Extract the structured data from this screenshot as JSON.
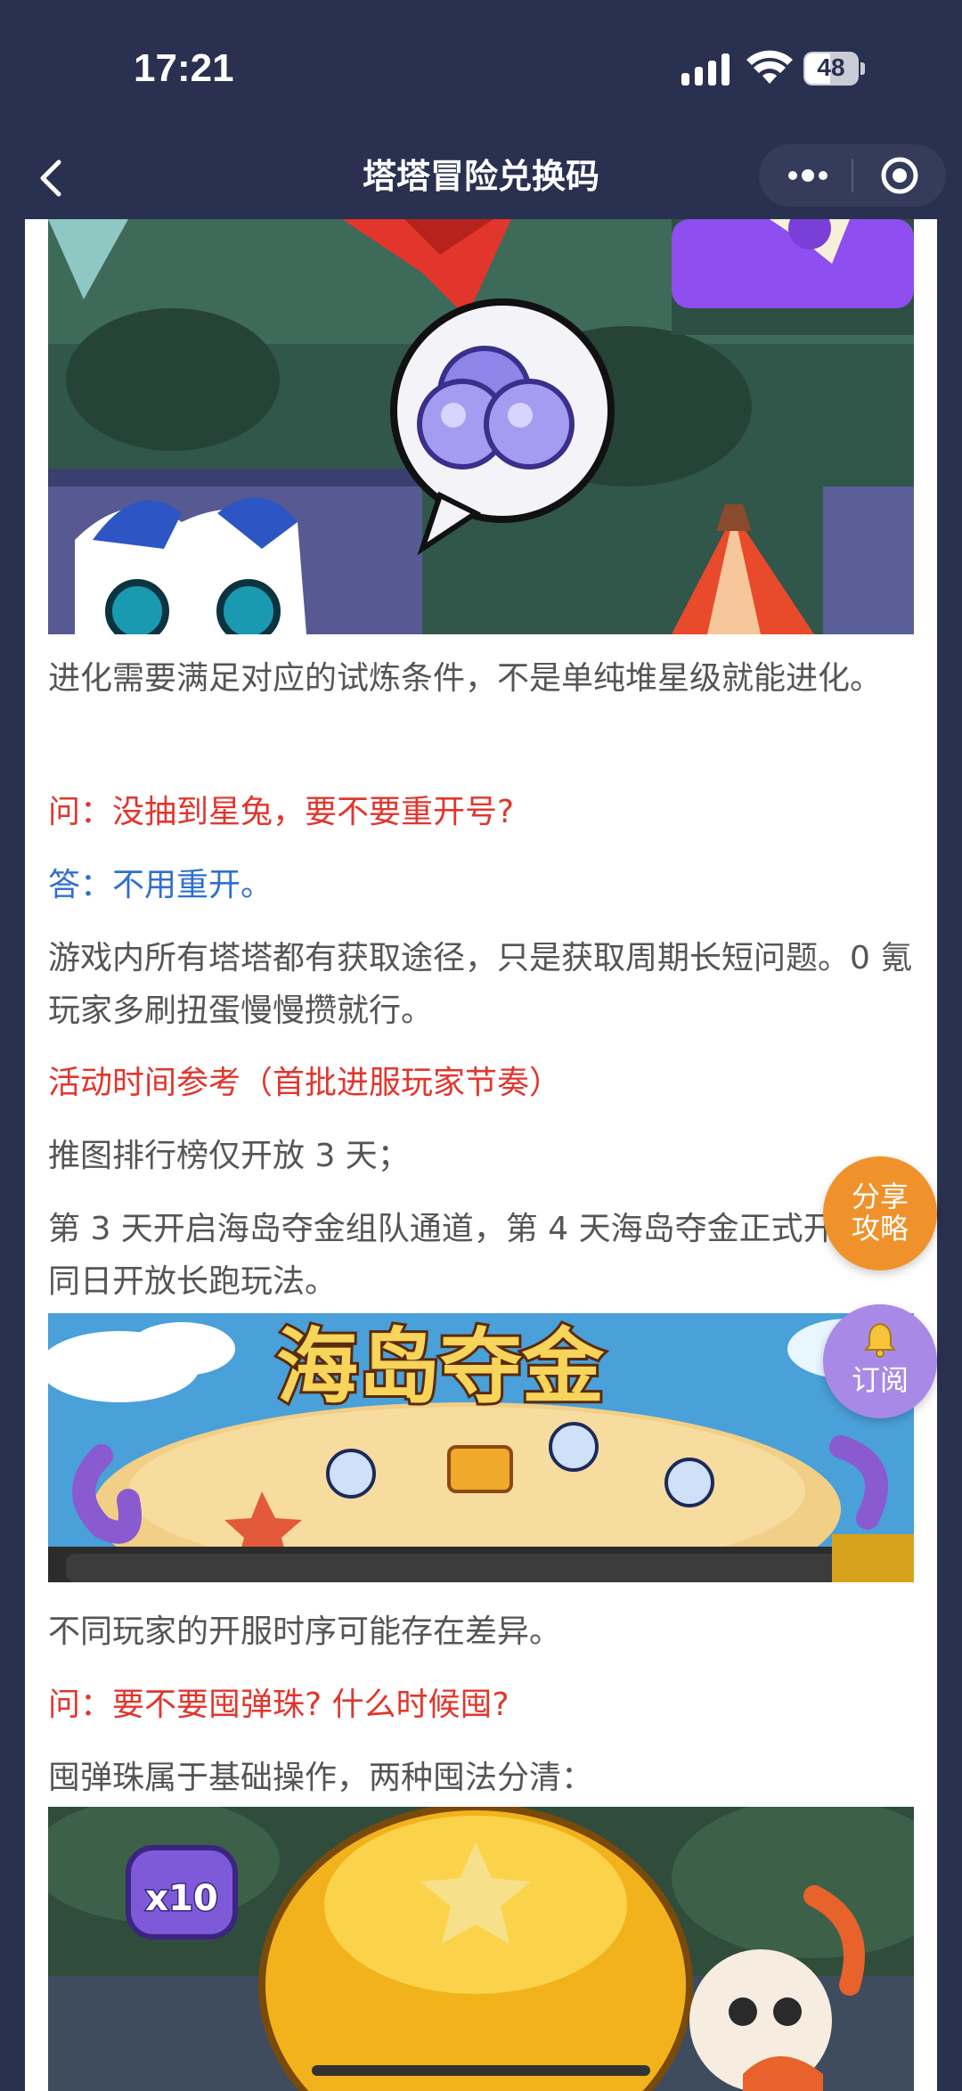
{
  "status_bar": {
    "time": "17:21",
    "battery": "48"
  },
  "nav": {
    "title": "塔塔冒险兑换码"
  },
  "article": {
    "p1": "进化需要满足对应的试炼条件，不是单纯堆星级就能进化。",
    "q1": "问：没抽到星兔，要不要重开号?",
    "a1": "答：不用重开。",
    "p2": "游戏内所有塔塔都有获取途径，只是获取周期长短问题。0 氪玩家多刷扭蛋慢慢攒就行。",
    "h1": "活动时间参考（首批进服玩家节奏）",
    "p3": "推图排行榜仅开放 3 天；",
    "p4": "第 3 天开启海岛夺金组队通道，第 4 天海岛夺金正式开启，同日开放长跑玩法。",
    "banner_text": "海岛夺金",
    "p5": "不同玩家的开服时序可能存在差异。",
    "q2": "问：要不要囤弹珠? 什么时候囤?",
    "p6": "囤弹珠属于基础操作，两种囤法分清：",
    "img3_badge": "x10"
  },
  "floating": {
    "share_label": "分享攻略",
    "share_line1": "分享",
    "share_line2": "攻略",
    "subscribe_label": "订阅"
  }
}
